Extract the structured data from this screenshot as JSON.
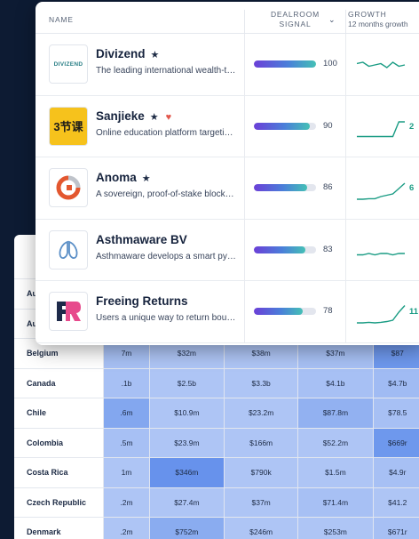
{
  "colors": {
    "accent_green": "#1a9c84",
    "bar_start": "#6b3fd8",
    "bar_end": "#44c0b6",
    "heart": "#e2574c"
  },
  "companies_table": {
    "headers": {
      "name": "NAME",
      "signal_line1": "DEALROOM",
      "signal_line2": "SIGNAL",
      "growth_line1": "GROWTH",
      "growth_line2": "12 months growth"
    },
    "rows": [
      {
        "name": "Divizend",
        "description": "The leading international wealth-t…",
        "signal": 100,
        "starred": true,
        "favorite": false,
        "growth_value": "",
        "logo": "divizend-logo",
        "logo_text": "DIVIZEND",
        "spark": [
          0.55,
          0.6,
          0.45,
          0.5,
          0.55,
          0.4,
          0.6,
          0.45,
          0.5
        ]
      },
      {
        "name": "Sanjieke",
        "description": "Online education platform targeti…",
        "signal": 90,
        "starred": true,
        "favorite": true,
        "growth_value": "2",
        "logo": "sanjieke-logo",
        "logo_text": "3节课",
        "spark": [
          0.15,
          0.15,
          0.15,
          0.15,
          0.15,
          0.15,
          0.15,
          0.7,
          0.7
        ]
      },
      {
        "name": "Anoma",
        "description": "A sovereign, proof-of-stake blockc…",
        "signal": 86,
        "starred": true,
        "favorite": false,
        "growth_value": "6",
        "logo": "anoma-logo",
        "logo_text": "",
        "spark": [
          0.1,
          0.1,
          0.12,
          0.12,
          0.2,
          0.25,
          0.3,
          0.5,
          0.7
        ]
      },
      {
        "name": "Asthmaware BV",
        "description": "Asthmaware develops a smart pyj…",
        "signal": 83,
        "starred": false,
        "favorite": false,
        "growth_value": "",
        "logo": "asthmaware-logo",
        "logo_text": "",
        "spark": [
          0.35,
          0.35,
          0.4,
          0.35,
          0.4,
          0.4,
          0.35,
          0.4,
          0.4
        ]
      },
      {
        "name": "Freeing Returns",
        "description": "Users a unique way to return boug…",
        "signal": 78,
        "starred": false,
        "favorite": false,
        "growth_value": "11",
        "logo": "freeing-returns-logo",
        "logo_text": "",
        "spark": [
          0.1,
          0.1,
          0.12,
          0.1,
          0.12,
          0.15,
          0.2,
          0.5,
          0.75
        ]
      }
    ]
  },
  "heatmap": {
    "rows": [
      {
        "country": "Au",
        "cells": [
          "",
          "",
          "",
          "",
          ""
        ]
      },
      {
        "country": "Au",
        "cells": [
          "",
          "",
          "",
          "",
          ""
        ]
      },
      {
        "country": "Belgium",
        "cells": [
          "7m",
          "$32m",
          "$38m",
          "$37m",
          "$87"
        ]
      },
      {
        "country": "Canada",
        "cells": [
          ".1b",
          "$2.5b",
          "$3.3b",
          "$4.1b",
          "$4.7b"
        ]
      },
      {
        "country": "Chile",
        "cells": [
          ".6m",
          "$10.9m",
          "$23.2m",
          "$87.8m",
          "$78.5"
        ]
      },
      {
        "country": "Colombia",
        "cells": [
          ".5m",
          "$23.9m",
          "$166m",
          "$52.2m",
          "$669r"
        ]
      },
      {
        "country": "Costa Rica",
        "cells": [
          "1m",
          "$346m",
          "$790k",
          "$1.5m",
          "$4.9r"
        ]
      },
      {
        "country": "Czech Republic",
        "cells": [
          ".2m",
          "$27.4m",
          "$37m",
          "$71.4m",
          "$41.2"
        ]
      },
      {
        "country": "Denmark",
        "cells": [
          ".2m",
          "$752m",
          "$246m",
          "$253m",
          "$671r"
        ]
      }
    ],
    "intensity": [
      [
        0.3,
        0.3,
        0.3,
        0.3,
        0.3
      ],
      [
        0.3,
        0.3,
        0.3,
        0.3,
        0.3
      ],
      [
        0.35,
        0.3,
        0.3,
        0.35,
        0.75
      ],
      [
        0.35,
        0.3,
        0.3,
        0.35,
        0.4
      ],
      [
        0.6,
        0.3,
        0.3,
        0.5,
        0.35
      ],
      [
        0.35,
        0.3,
        0.3,
        0.3,
        0.75
      ],
      [
        0.3,
        0.8,
        0.3,
        0.3,
        0.35
      ],
      [
        0.3,
        0.3,
        0.3,
        0.35,
        0.3
      ],
      [
        0.3,
        0.55,
        0.3,
        0.3,
        0.35
      ]
    ]
  }
}
